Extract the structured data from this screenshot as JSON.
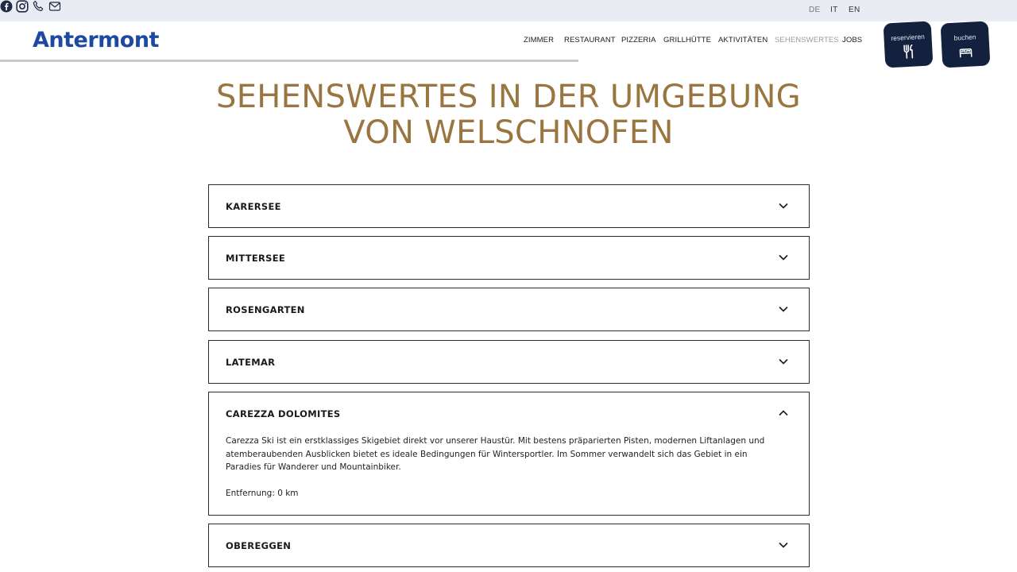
{
  "topbar": {
    "social": [
      {
        "icon": "facebook-icon"
      },
      {
        "icon": "instagram-icon"
      },
      {
        "icon": "phone-icon"
      },
      {
        "icon": "mail-icon"
      }
    ],
    "languages": [
      {
        "label": "DE",
        "active": true
      },
      {
        "label": "IT",
        "active": false
      },
      {
        "label": "EN",
        "active": false
      }
    ]
  },
  "header": {
    "logo": "Antermont",
    "nav": [
      {
        "label": "ZIMMER"
      },
      {
        "label": "RESTAURANT"
      },
      {
        "label": "PIZZERIA"
      },
      {
        "label": "GRILLHÜTTE"
      },
      {
        "label": "AKTIVITÄTEN"
      },
      {
        "label": "SEHENSWERTES"
      },
      {
        "label": "JOBS"
      }
    ],
    "active_nav": "SEHENSWERTES",
    "cta": [
      {
        "label": "reservieren",
        "icon": "cutlery-icon"
      },
      {
        "label": "buchen",
        "icon": "bed-icon"
      }
    ]
  },
  "main": {
    "title_line1": "SEHENSWERTES IN DER UMGEBUNG",
    "title_line2": "VON WELSCHNOFEN",
    "accordion": [
      {
        "title": "KARERSEE",
        "expanded": false
      },
      {
        "title": "MITTERSEE",
        "expanded": false
      },
      {
        "title": "ROSENGARTEN",
        "expanded": false
      },
      {
        "title": "LATEMAR",
        "expanded": false
      },
      {
        "title": "CAREZZA DOLOMITES",
        "expanded": true,
        "description": "Carezza Ski ist ein erstklassiges Skigebiet direkt vor unserer Haustür. Mit bestens präparierten Pisten, modernen Liftanlagen und atemberaubenden Ausblicken bietet es ideale Bedingungen für Wintersportler. Im Sommer verwandelt sich das Gebiet in ein Paradies für Wanderer und Mountainbiker.",
        "distance": "Entfernung: 0 km"
      },
      {
        "title": "OBEREGGEN",
        "expanded": false
      }
    ]
  },
  "colors": {
    "accent_gold": "#9a7540",
    "brand_blue": "#1d4aa0",
    "cta_navy": "#13213f",
    "topbar_bg": "#eaecf3"
  }
}
